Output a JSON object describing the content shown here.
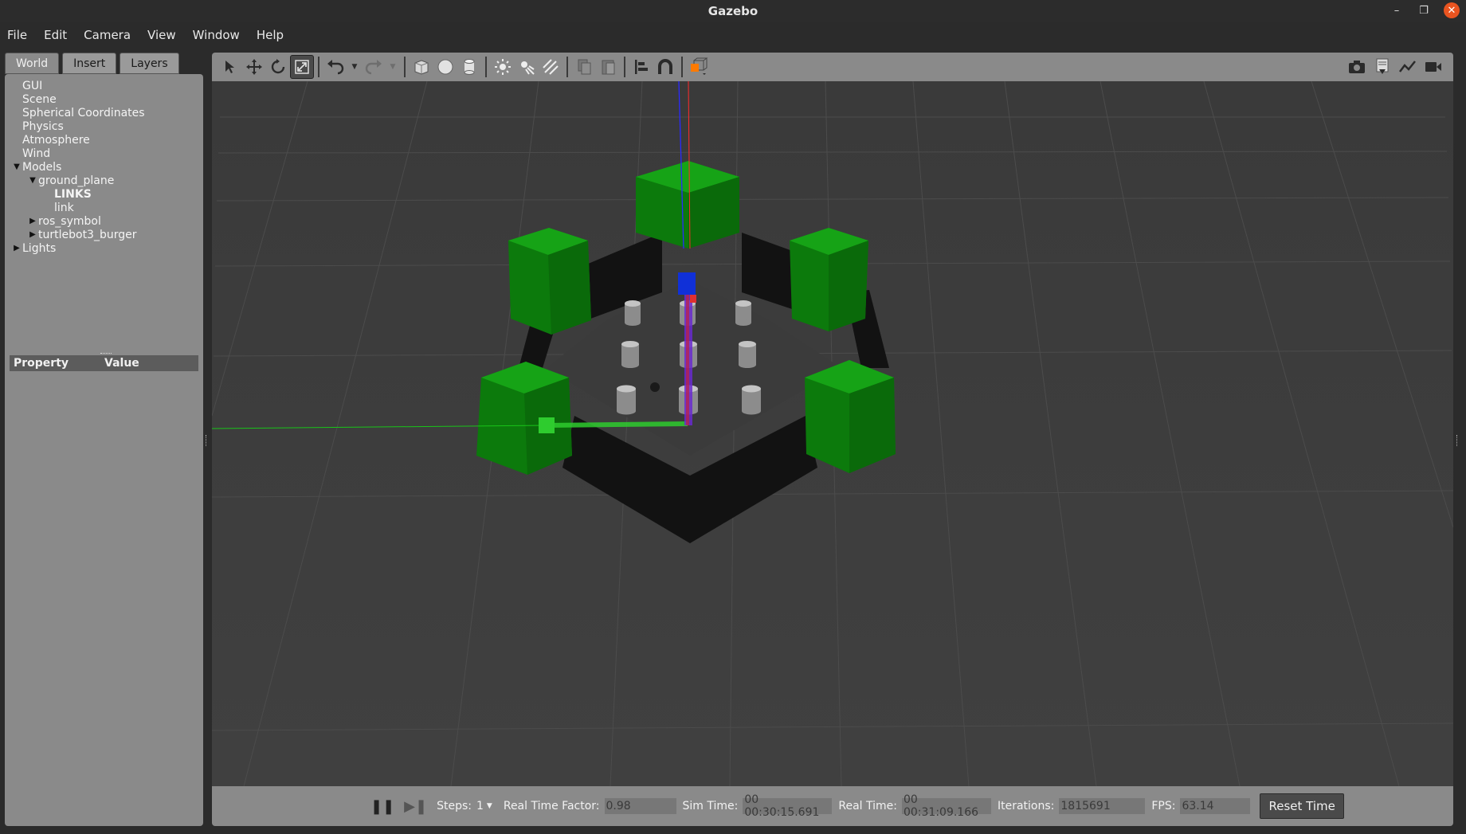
{
  "window": {
    "title": "Gazebo"
  },
  "menu": [
    "File",
    "Edit",
    "Camera",
    "View",
    "Window",
    "Help"
  ],
  "tabs": [
    "World",
    "Insert",
    "Layers"
  ],
  "tree": [
    {
      "label": "GUI",
      "indent": 0,
      "arrow": ""
    },
    {
      "label": "Scene",
      "indent": 0,
      "arrow": ""
    },
    {
      "label": "Spherical Coordinates",
      "indent": 0,
      "arrow": ""
    },
    {
      "label": "Physics",
      "indent": 0,
      "arrow": ""
    },
    {
      "label": "Atmosphere",
      "indent": 0,
      "arrow": ""
    },
    {
      "label": "Wind",
      "indent": 0,
      "arrow": ""
    },
    {
      "label": "Models",
      "indent": 0,
      "arrow": "expanded"
    },
    {
      "label": "ground_plane",
      "indent": 1,
      "arrow": "expanded"
    },
    {
      "label": "LINKS",
      "indent": 2,
      "arrow": "",
      "bold": true
    },
    {
      "label": "link",
      "indent": 2,
      "arrow": ""
    },
    {
      "label": "ros_symbol",
      "indent": 1,
      "arrow": "collapsed"
    },
    {
      "label": "turtlebot3_burger",
      "indent": 1,
      "arrow": "collapsed"
    },
    {
      "label": "Lights",
      "indent": 0,
      "arrow": "collapsed"
    }
  ],
  "properties": {
    "col_property": "Property",
    "col_value": "Value"
  },
  "toolbar": {
    "left": [
      "select-mode-icon",
      "translate-mode-icon",
      "rotate-mode-icon",
      "scale-mode-icon",
      "undo-icon",
      "redo-icon",
      "box-icon",
      "sphere-icon",
      "cylinder-icon",
      "point-light-icon",
      "spot-light-icon",
      "directional-light-icon",
      "copy-icon",
      "paste-icon",
      "align-icon",
      "snap-icon",
      "view-angle-icon"
    ],
    "right": [
      "screenshot-icon",
      "log-icon",
      "plot-icon",
      "record-video-icon"
    ]
  },
  "status": {
    "steps_label": "Steps:",
    "steps_value": "1",
    "rtf_label": "Real Time Factor:",
    "rtf_value": "0.98",
    "sim_time_label": "Sim Time:",
    "sim_time_value": "00 00:30:15.691",
    "real_time_label": "Real Time:",
    "real_time_value": "00 00:31:09.166",
    "iterations_label": "Iterations:",
    "iterations_value": "1815691",
    "fps_label": "FPS:",
    "fps_value": "63.14",
    "reset_label": "Reset Time"
  },
  "colors": {
    "viewport_bg": "#3d3d3d",
    "panel_bg": "#8a8a8a",
    "pillar_green": "#0f8a0f",
    "wall_black": "#121212",
    "close_button": "#e95420"
  }
}
